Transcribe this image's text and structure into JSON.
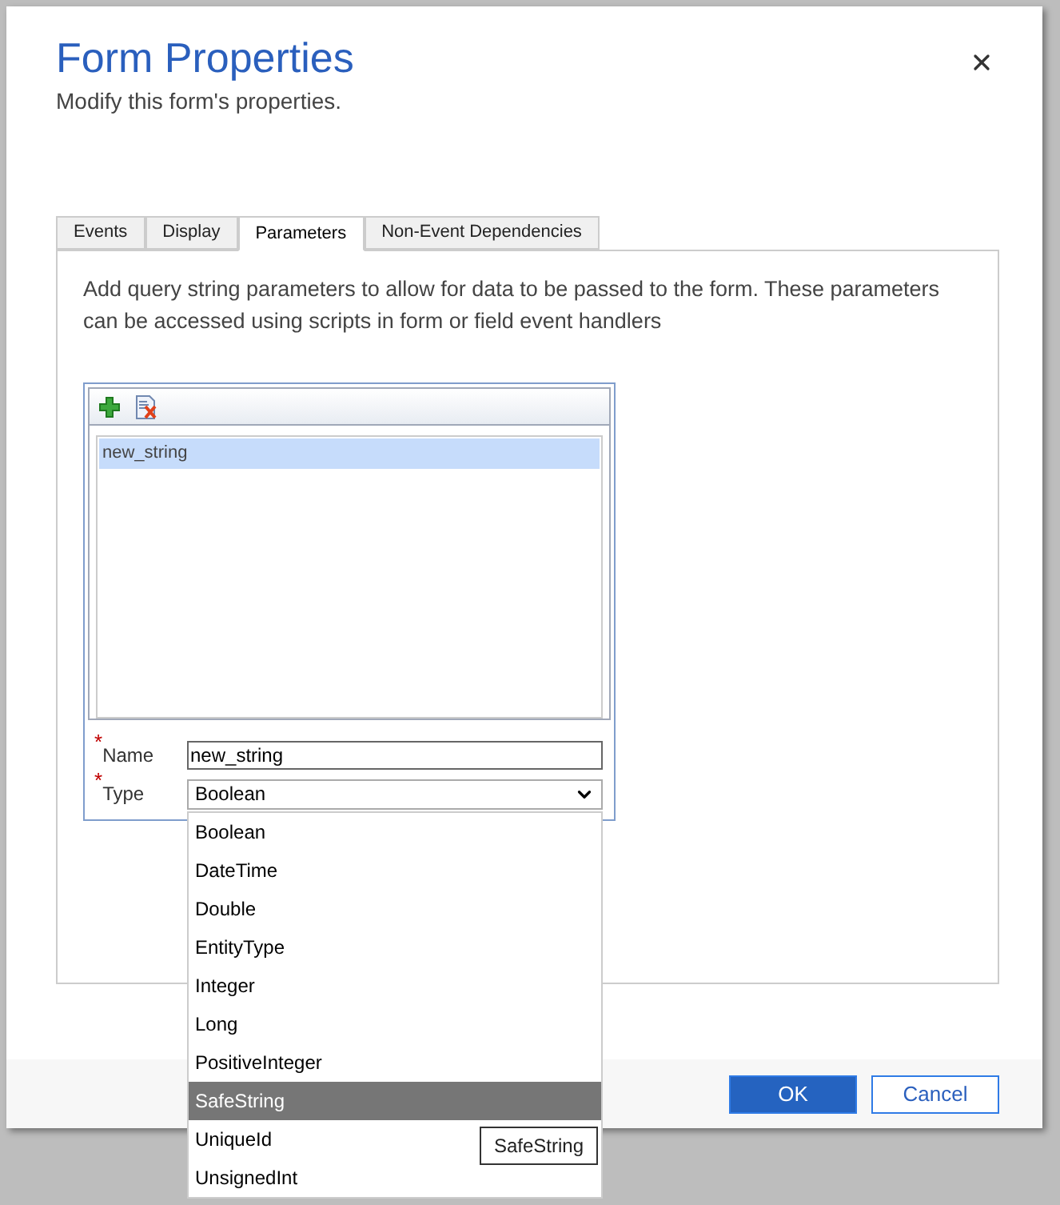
{
  "dialog": {
    "title": "Form Properties",
    "subtitle": "Modify this form's properties."
  },
  "tabs": [
    {
      "label": "Events",
      "selected": false
    },
    {
      "label": "Display",
      "selected": false
    },
    {
      "label": "Parameters",
      "selected": true
    },
    {
      "label": "Non-Event Dependencies",
      "selected": false
    }
  ],
  "description": "Add query string parameters to allow for data to be passed to the form. These parameters can be accessed using scripts in form or field event handlers",
  "parameters": [
    {
      "name": "new_string",
      "selected": true
    }
  ],
  "fields": [
    {
      "kind": "text",
      "required_mark": "*",
      "label": "Name",
      "value": "new_string"
    },
    {
      "kind": "select",
      "required_mark": "*",
      "label": "Type",
      "value": "Boolean",
      "expanded": true
    }
  ],
  "type_options": [
    {
      "label": "Boolean",
      "selected": false
    },
    {
      "label": "DateTime",
      "selected": false
    },
    {
      "label": "Double",
      "selected": false
    },
    {
      "label": "EntityType",
      "selected": false
    },
    {
      "label": "Integer",
      "selected": false
    },
    {
      "label": "Long",
      "selected": false
    },
    {
      "label": "PositiveInteger",
      "selected": false
    },
    {
      "label": "SafeString",
      "selected": true
    },
    {
      "label": "UniqueId",
      "selected": false
    },
    {
      "label": "UnsignedInt",
      "selected": false
    }
  ],
  "tooltip": "SafeString",
  "buttons": [
    {
      "label": "OK",
      "kind": "primary"
    },
    {
      "label": "Cancel",
      "kind": "secondary"
    }
  ]
}
